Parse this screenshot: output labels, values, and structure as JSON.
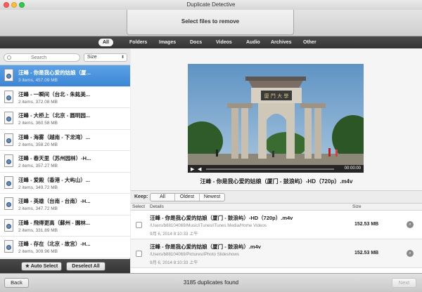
{
  "window": {
    "title": "Duplicate Detective"
  },
  "toolbar": {
    "select_label": "Select files to remove"
  },
  "categories": [
    "All",
    "Folders",
    "Images",
    "Docs",
    "Videos",
    "Audio",
    "Archives",
    "Other"
  ],
  "sidebar": {
    "search_placeholder": "Search",
    "sort_label": "Size",
    "items": [
      {
        "name": "汪峰 - 你是我心爱的姑娘（厦...",
        "meta": "3 items, 457.09 MB"
      },
      {
        "name": "汪峰 - 一瞬间（台北 - 朱銘美...",
        "meta": "2 items, 372.08 MB"
      },
      {
        "name": "汪峰 - 大桥上（北京 - 圆明园...",
        "meta": "2 items, 360.58 MB"
      },
      {
        "name": "汪峰 - 海雾（越南 - 下龙湾）...",
        "meta": "2 items, 358.20 MB"
      },
      {
        "name": "汪峰 - 春天里（苏州园林）-H...",
        "meta": "2 items, 357.27 MB"
      },
      {
        "name": "汪峰 - 爱殿（香港 - 大屿山）...",
        "meta": "2 items, 349.72 MB"
      },
      {
        "name": "汪峰 - 英雄（台南 - 台南）-H...",
        "meta": "2 items, 347.72 MB"
      },
      {
        "name": "汪峰 - 飛得更高（蘇州 - 園林...",
        "meta": "2 items, 331.89 MB"
      },
      {
        "name": "汪峰 - 存在（北京 - 故宫）-H...",
        "meta": "2 items, 309.96 MB"
      }
    ],
    "auto_select_label": "★ Auto Select",
    "deselect_all_label": "Deselect All"
  },
  "preview": {
    "title": "汪峰 - 你是我心爱的姑娘（厦门 - 鼓浪屿）-HD（720p）.m4v",
    "time": "00:00:00",
    "gate_text": "廈 門 大 學"
  },
  "keep": {
    "label": "Keep:",
    "options": [
      "All",
      "Oldest",
      "Newest"
    ]
  },
  "table": {
    "columns": {
      "select": "Select",
      "details": "Details",
      "size": "Size"
    },
    "rows": [
      {
        "name": "汪峰 - 你是我心爱的姑娘（厦门 - 鼓浪屿）-HD（720p）.m4v",
        "path": "/Users/b88104069/Music/iTunes/iTunes Media/Home Videos",
        "date": "9月 6, 2014 8:10:33 上午",
        "size": "152.53 MB"
      },
      {
        "name": "汪峰 - 你是我心爱的姑娘（厦门 - 鼓浪屿）.m4v",
        "path": "/Users/b88104069/Pictures/iPhoto Slideshows",
        "date": "9月 6, 2014 8:10:33 上午",
        "size": "152.53 MB"
      }
    ]
  },
  "status": {
    "back_label": "Back",
    "next_label": "Next",
    "count_text": "3185 duplicates found"
  }
}
